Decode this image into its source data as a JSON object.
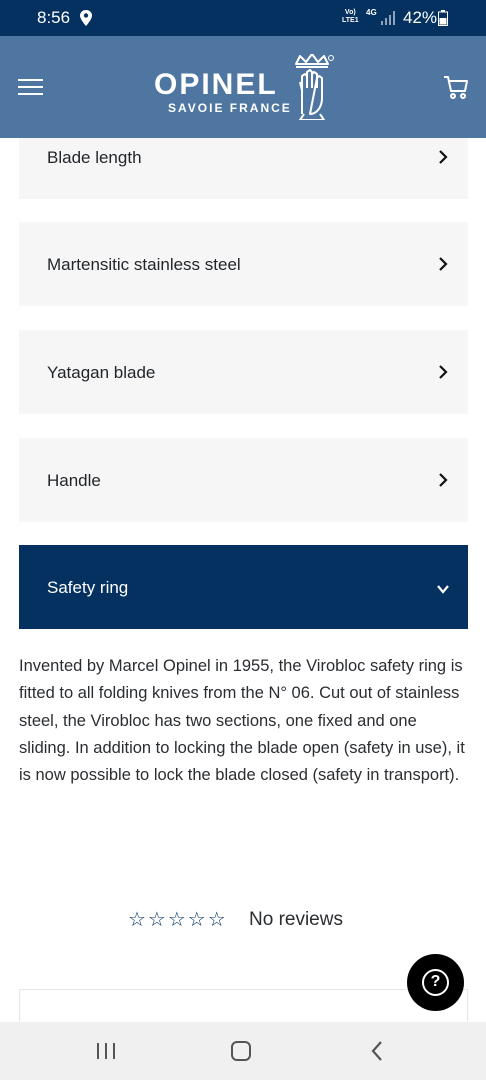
{
  "status_bar": {
    "time": "8:56",
    "volte_line1": "Vo)",
    "volte_line2": "LTE1",
    "network": "4G",
    "battery": "42%"
  },
  "header": {
    "brand": "OPINEL",
    "tagline": "SAVOIE FRANCE",
    "menu_icon": "hamburger-menu-icon",
    "cart_icon": "shopping-cart-icon",
    "background_color": "#4e76a1"
  },
  "accordion": {
    "items": [
      {
        "label": "Blade length",
        "expanded": false
      },
      {
        "label": "Martensitic stainless steel",
        "expanded": false
      },
      {
        "label": "Yatagan blade",
        "expanded": false
      },
      {
        "label": "Handle",
        "expanded": false
      },
      {
        "label": "Safety ring",
        "expanded": true
      }
    ],
    "open_content": "Invented by Marcel Opinel in 1955, the Virobloc safety ring is fitted to all folding knives from the N° 06. Cut out of stainless steel, the Virobloc has two sections, one fixed and one sliding. In addition to locking the blade open (safety in use), it is now possible to lock the blade closed (safety in transport).",
    "active_color": "#04315f"
  },
  "reviews": {
    "stars": "☆☆☆☆☆",
    "rating": 0,
    "max_rating": 5,
    "label": "No reviews"
  },
  "help_button": {
    "symbol": "?",
    "icon": "help-question-icon"
  },
  "nav_bar": {
    "recents_icon": "recents-icon",
    "home_icon": "home-icon",
    "back_icon": "back-icon"
  }
}
